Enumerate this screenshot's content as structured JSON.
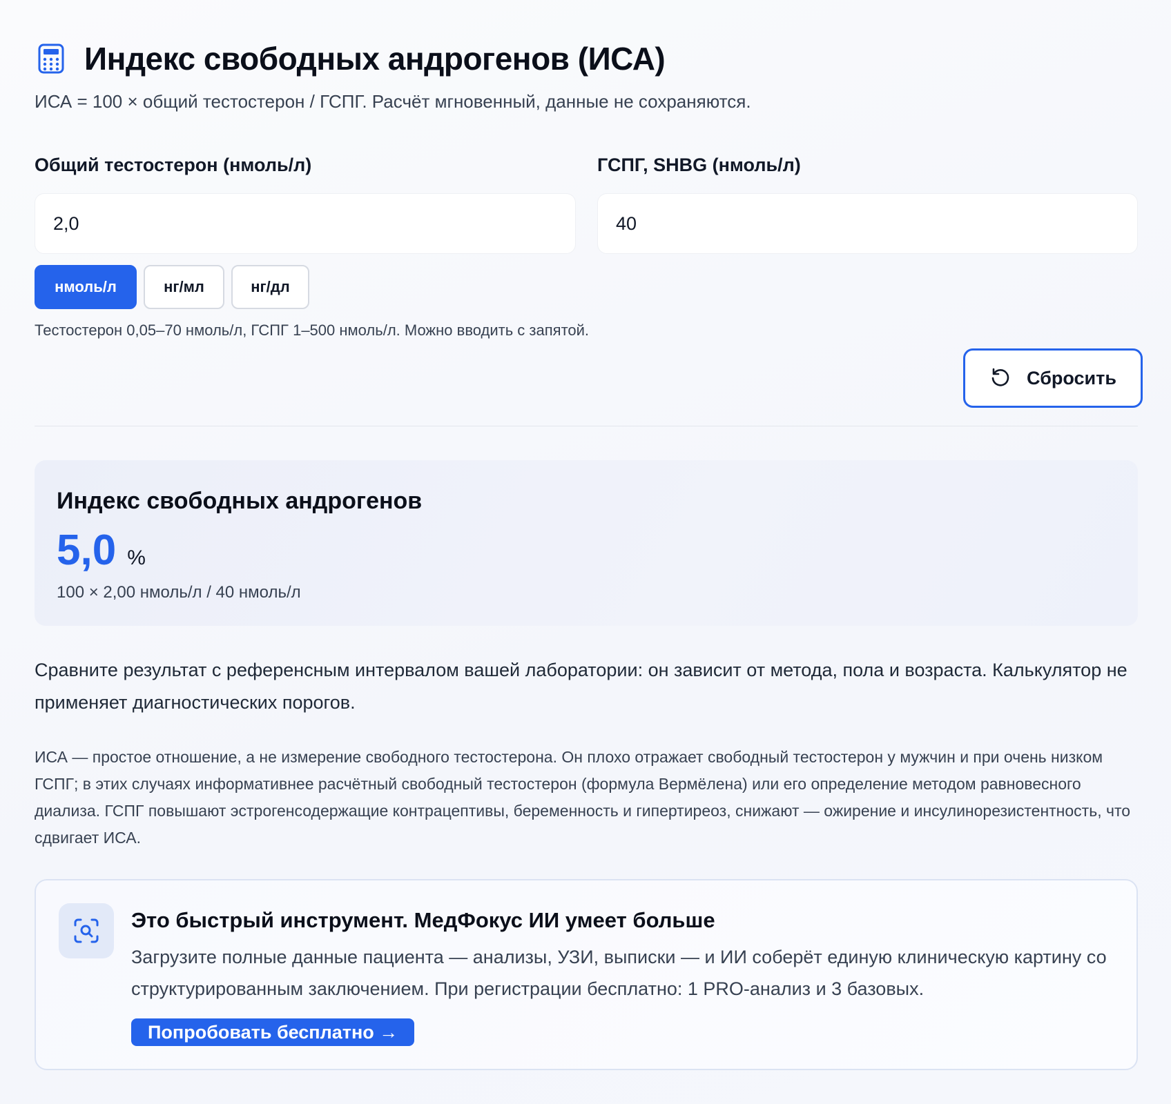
{
  "header": {
    "icon": "calculator-icon",
    "title": "Индекс свободных андрогенов (ИСА)",
    "subtitle": "ИСА = 100 × общий тестостерон / ГСПГ. Расчёт мгновенный, данные не сохраняются."
  },
  "form": {
    "testosterone_label": "Общий тестостерон (нмоль/л)",
    "testosterone_value": "2,0",
    "shbg_label": "ГСПГ, SHBG (нмоль/л)",
    "shbg_value": "40",
    "units": [
      {
        "label": "нмоль/л",
        "active": true
      },
      {
        "label": "нг/мл",
        "active": false
      },
      {
        "label": "нг/дл",
        "active": false
      }
    ],
    "hint": "Тестостерон 0,05–70 нмоль/л, ГСПГ 1–500 нмоль/л. Можно вводить с запятой.",
    "reset_label": "Сбросить",
    "reset_icon": "reset-icon"
  },
  "result": {
    "title": "Индекс свободных андрогенов",
    "value": "5,0",
    "unit": "%",
    "formula": "100 × 2,00 нмоль/л / 40 нмоль/л"
  },
  "compare_text": "Сравните результат с референсным интервалом вашей лаборатории: он зависит от метода, пола и возраста. Калькулятор не применяет диагностических порогов.",
  "note_text": "ИСА — простое отношение, а не измерение свободного тестостерона. Он плохо отражает свободный тестостерон у мужчин и при очень низком ГСПГ; в этих случаях информативнее расчётный свободный тестостерон (формула Вермёлена) или его определение методом равновесного диализа. ГСПГ повышают эстрогенсодержащие контрацептивы, беременность и гипертиреоз, снижают — ожирение и инсулинорезистентность, что сдвигает ИСА.",
  "promo": {
    "icon": "scan-search-icon",
    "title": "Это быстрый инструмент. МедФокус ИИ умеет больше",
    "text": "Загрузите полные данные пациента — анализы, УЗИ, выписки — и ИИ соберёт единую клиническую картину со структурированным заключением. При регистрации бесплатно: 1 PRO-анализ и 3 базовых.",
    "button_label": "Попробовать бесплатно →"
  },
  "colors": {
    "accent": "#2563eb",
    "text": "#111827",
    "muted": "#374151",
    "card": "#eef1fa"
  }
}
